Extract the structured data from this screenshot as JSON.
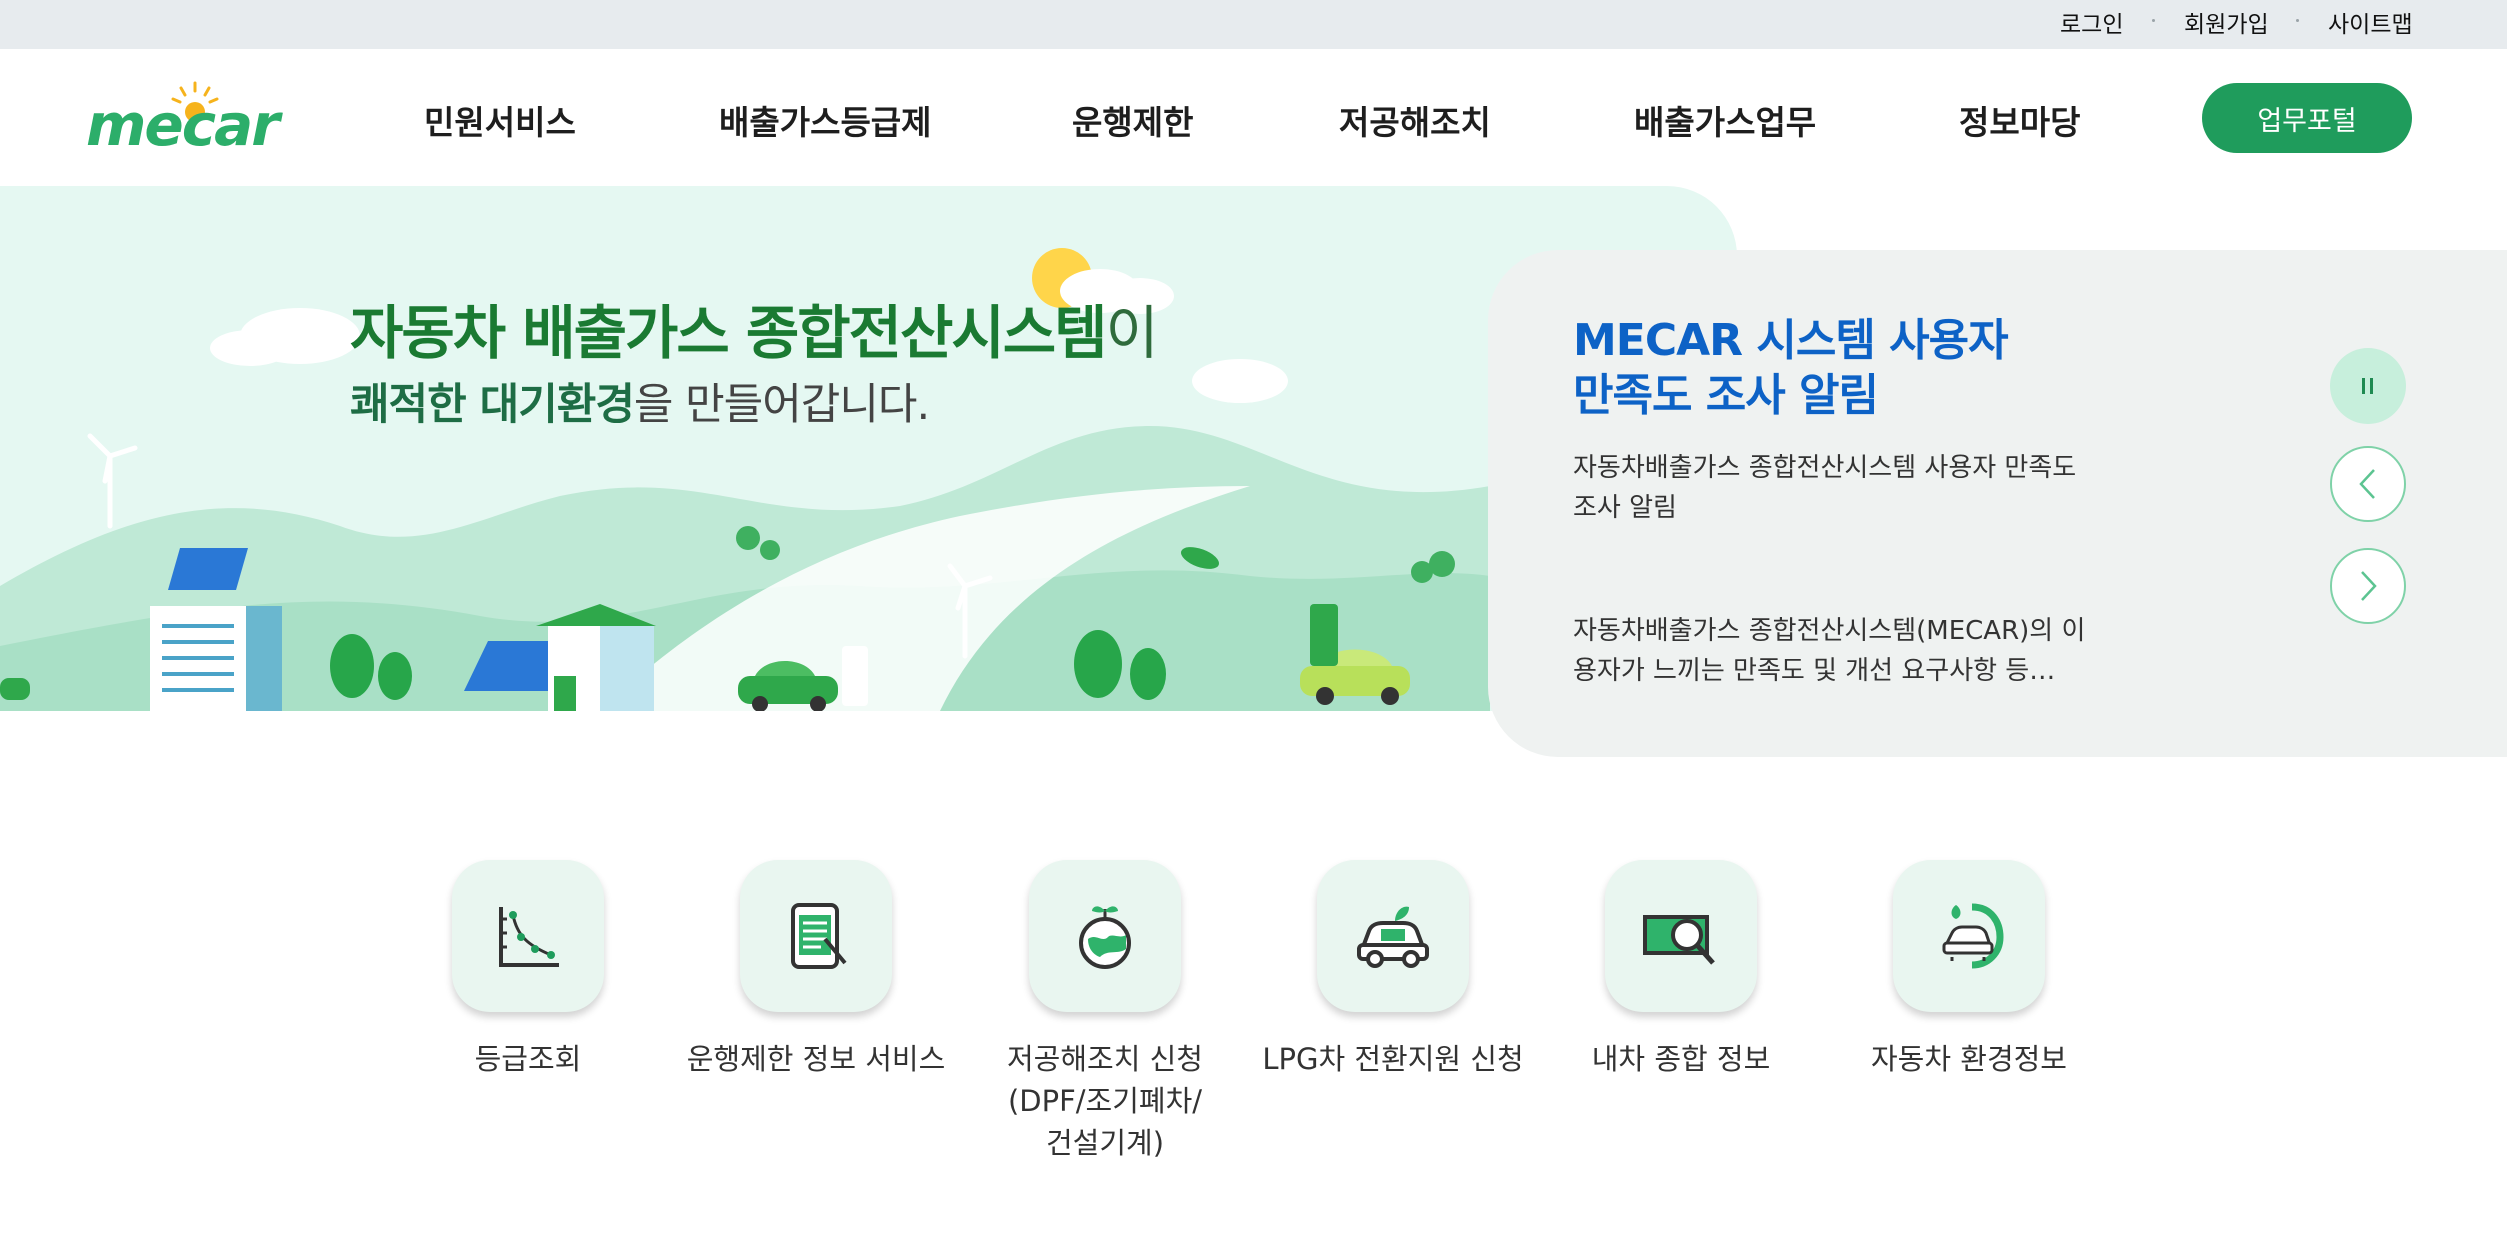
{
  "utility_nav": {
    "login": "로그인",
    "signup": "회원가입",
    "sitemap": "사이트맵"
  },
  "logo": {
    "text": "mecar"
  },
  "nav": {
    "items": [
      {
        "label": "민원서비스"
      },
      {
        "label": "배출가스등급제"
      },
      {
        "label": "운행제한"
      },
      {
        "label": "저공해조치"
      },
      {
        "label": "배출가스업무"
      },
      {
        "label": "정보마당"
      }
    ],
    "portal_button": "업무포털"
  },
  "hero": {
    "title_main": "자동차 배출가스 종합전산시스템",
    "title_suffix": "이",
    "subtitle_highlight": "쾌적한 대기환경",
    "subtitle_rest": "을 만들어갑니다."
  },
  "notice": {
    "title_line1": "MECAR 시스템 사용자",
    "title_line2": "만족도 조사 알림",
    "summary": "자동차배출가스 종합전산시스템 사용자 만족도 조사 알림",
    "body": "자동차배출가스 종합전산시스템(MECAR)의 이용자가 느끼는 만족도 및 개선 요구사항 등…",
    "controls": {
      "pause_icon": "pause-icon",
      "prev_icon": "chevron-left-icon",
      "next_icon": "chevron-right-icon"
    }
  },
  "services": [
    {
      "label": "등급조회",
      "icon": "graph-icon"
    },
    {
      "label": "운행제한 정보 서비스",
      "icon": "tablet-document-icon"
    },
    {
      "label": "저공해조치 신청\n(DPF/조기폐차/\n건설기계)",
      "icon": "earth-sprout-icon"
    },
    {
      "label": "LPG차 전환지원 신청",
      "icon": "eco-car-icon"
    },
    {
      "label": "내차 종합 정보",
      "icon": "money-search-icon"
    },
    {
      "label": "자동차 환경정보",
      "icon": "car-leaf-icon"
    }
  ],
  "colors": {
    "brand_green": "#1f9c5c",
    "notice_blue": "#0d62c6",
    "hero_bg": "#e5f8f2"
  }
}
